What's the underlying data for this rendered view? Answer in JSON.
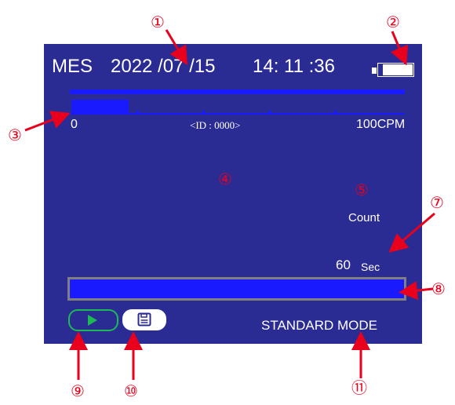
{
  "device": {
    "mode_prefix": "MES",
    "date": "2022 /07 /15",
    "time": "14: 11 :36",
    "battery_level": 0.85,
    "scale_min": "0",
    "scale_max": "100CPM",
    "id_label": "<ID : 0000>",
    "count_label": "Count",
    "time_value": "60",
    "time_unit": "Sec",
    "rate_fill": 0.12,
    "progress_fill": 1.0,
    "mode_label": "STANDARD MODE"
  },
  "callouts": [
    "①",
    "②",
    "③",
    "④",
    "⑤",
    "⑦",
    "⑧",
    "⑨",
    "⑩",
    "⑪"
  ],
  "colors": {
    "screen_bg": "#2b2b94",
    "accent_blue": "#1a1aff",
    "progress_border": "#808080",
    "play_border": "#1db954",
    "annotation_red": "#e8001c",
    "text_white": "#ffffff"
  }
}
